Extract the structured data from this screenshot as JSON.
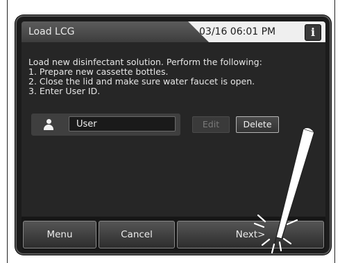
{
  "header": {
    "title": "Load LCG",
    "datetime": "03/16 06:01 PM",
    "info_icon": "i"
  },
  "instructions": {
    "line1": "Load new disinfectant solution. Perform the following:",
    "line2": "1. Prepare new cassette bottles.",
    "line3": "2. Close the lid and make sure water faucet is open.",
    "line4": "3. Enter User ID."
  },
  "user": {
    "icon": "user-icon",
    "value": "User"
  },
  "actions": {
    "edit_label": "Edit",
    "delete_label": "Delete"
  },
  "bottom_bar": {
    "menu_label": "Menu",
    "cancel_label": "Cancel",
    "next_label": "Next>"
  },
  "icons": {
    "stylus": "stylus-icon",
    "tap_highlight": "tap-burst-icon"
  }
}
